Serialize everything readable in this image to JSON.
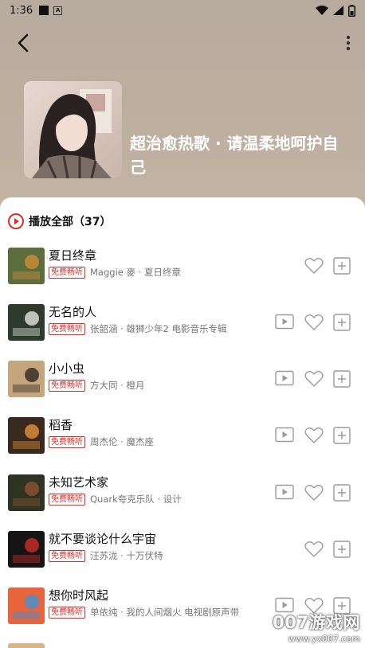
{
  "status_bar": {
    "time": "1:36",
    "battery_label": ""
  },
  "header": {
    "back_icon": "chevron-left-icon",
    "more_icon": "more-vertical-icon"
  },
  "playlist": {
    "title": "超治愈热歌 · 请温柔地呵护自己"
  },
  "play_all": {
    "label": "播放全部（37）",
    "color": "#e02b28"
  },
  "badge_label": "免费畅听",
  "songs": [
    {
      "title": "夏日终章",
      "meta": "Maggie 麥 · 夏日终章",
      "has_mv": false
    },
    {
      "title": "无名的人",
      "meta": "张韶涵 · 雄狮少年2 电影音乐专辑",
      "has_mv": true
    },
    {
      "title": "小小虫",
      "meta": "方大同 · 橙月",
      "has_mv": true
    },
    {
      "title": "稻香",
      "meta": "周杰伦 · 魔杰座",
      "has_mv": true
    },
    {
      "title": "未知艺术家",
      "meta": "Quark夸克乐队 · 设计",
      "has_mv": true
    },
    {
      "title": "就不要谈论什么宇宙",
      "meta": "汪苏泷 · 十万伏特",
      "has_mv": false
    },
    {
      "title": "想你时风起",
      "meta": "单依纯 · 我的人间烟火 电视剧原声带",
      "has_mv": true
    }
  ],
  "watermark": {
    "big": "007游戏网",
    "small": "www.yx007.com"
  }
}
